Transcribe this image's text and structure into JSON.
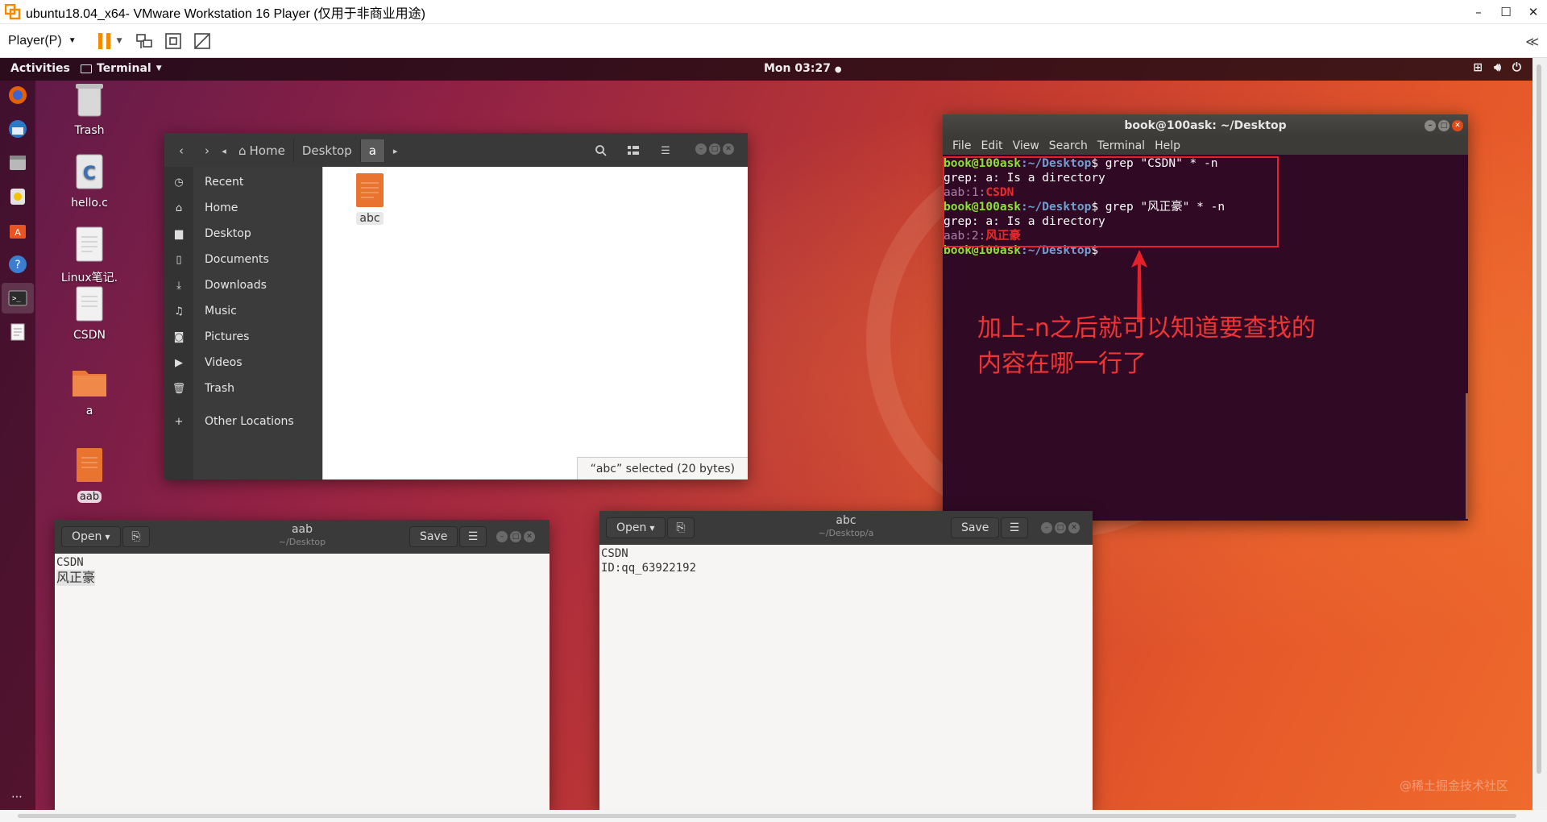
{
  "vm": {
    "title": "ubuntu18.04_x64- VMware Workstation 16 Player (仅用于非商业用途)",
    "player_menu": "Player(P)",
    "window_controls": [
      "–",
      "☐",
      "✕"
    ],
    "collapse": "≪",
    "brand_color": "#f38b00"
  },
  "topbar": {
    "activities": "Activities",
    "app_menu": "Terminal",
    "clock": "Mon 03:27"
  },
  "desktop_icons": [
    {
      "label": "Trash"
    },
    {
      "label": "hello.c"
    },
    {
      "label": "Linux笔记."
    },
    {
      "label": "CSDN"
    },
    {
      "label": "a"
    },
    {
      "label": "aab"
    }
  ],
  "files": {
    "crumbs": [
      "Home",
      "Desktop",
      "a"
    ],
    "sidebar": [
      "Recent",
      "Home",
      "Desktop",
      "Documents",
      "Downloads",
      "Music",
      "Pictures",
      "Videos",
      "Trash",
      "Other Locations"
    ],
    "file_name": "abc",
    "status": "“abc” selected  (20 bytes)"
  },
  "terminal": {
    "title": "book@100ask: ~/Desktop",
    "menu": [
      "File",
      "Edit",
      "View",
      "Search",
      "Terminal",
      "Help"
    ],
    "user_host": "book@100ask",
    "path": ":~/Desktop",
    "cmd1": "$ grep \"CSDN\" * -n",
    "err1": "grep: a: Is a directory",
    "res1_file": "aab:1:",
    "res1_match": "CSDN",
    "cmd2": "$ grep \"风正豪\" * -n",
    "err2": "grep: a: Is a directory",
    "res2_file": "aab:2:",
    "res2_match": "风正豪",
    "prompt_end": "$"
  },
  "annotation": {
    "line1": "加上-n之后就可以知道要查找的",
    "line2": "内容在哪一行了",
    "color": "#e5202a"
  },
  "gedit_aab": {
    "open": "Open",
    "title": "aab",
    "subtitle": "~/Desktop",
    "save": "Save",
    "lines": [
      "CSDN",
      "风正豪"
    ]
  },
  "gedit_abc": {
    "open": "Open",
    "title": "abc",
    "subtitle": "~/Desktop/a",
    "save": "Save",
    "lines": [
      "CSDN",
      "ID:qq_63922192"
    ]
  },
  "watermark": "@稀土掘金技术社区"
}
